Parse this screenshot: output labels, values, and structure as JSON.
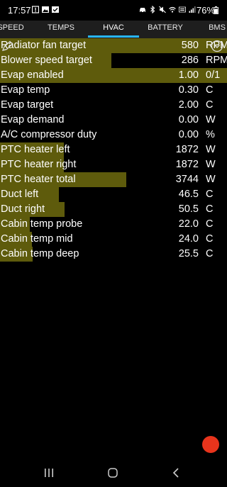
{
  "status_bar": {
    "time": "17:57",
    "battery": "76%",
    "left_icons": [
      "alert-icon",
      "gallery-icon",
      "check-icon"
    ],
    "right_icons": [
      "car-icon",
      "bluetooth-icon",
      "mute-icon",
      "wifi-icon",
      "volte-icon",
      "signal-icon"
    ]
  },
  "tabs": [
    {
      "label": "SPEED",
      "active": false
    },
    {
      "label": "TEMPS",
      "active": false
    },
    {
      "label": "HVAC",
      "active": true
    },
    {
      "label": "BATTERY",
      "active": false
    },
    {
      "label": "BMS",
      "active": false
    }
  ],
  "bar_color": "#5e5b0c",
  "accent_color": "#29b6f6",
  "rows": [
    {
      "label": "Radiator fan target",
      "value": "580",
      "unit": "RPM",
      "bar_fraction": 1.0
    },
    {
      "label": "Blower speed target",
      "value": "286",
      "unit": "RPM",
      "bar_fraction": 0.49
    },
    {
      "label": "Evap enabled",
      "value": "1.00",
      "unit": "0/1",
      "bar_fraction": 1.0
    },
    {
      "label": "Evap temp",
      "value": "0.30",
      "unit": "C",
      "bar_fraction": 0.0
    },
    {
      "label": "Evap target",
      "value": "2.00",
      "unit": "C",
      "bar_fraction": 0.0
    },
    {
      "label": "Evap demand",
      "value": "0.00",
      "unit": "W",
      "bar_fraction": 0.0
    },
    {
      "label": "A/C compressor duty",
      "value": "0.00",
      "unit": "%",
      "bar_fraction": 0.0
    },
    {
      "label": "PTC heater left",
      "value": "1872",
      "unit": "W",
      "bar_fraction": 0.28
    },
    {
      "label": "PTC heater right",
      "value": "1872",
      "unit": "W",
      "bar_fraction": 0.28
    },
    {
      "label": "PTC heater total",
      "value": "3744",
      "unit": "W",
      "bar_fraction": 0.555
    },
    {
      "label": "Duct left",
      "value": "46.5",
      "unit": "C",
      "bar_fraction": 0.26
    },
    {
      "label": "Duct right",
      "value": "50.5",
      "unit": "C",
      "bar_fraction": 0.285
    },
    {
      "label": "Cabin temp probe",
      "value": "22.0",
      "unit": "C",
      "bar_fraction": 0.13
    },
    {
      "label": "Cabin temp mid",
      "value": "24.0",
      "unit": "C",
      "bar_fraction": 0.14
    },
    {
      "label": "Cabin temp deep",
      "value": "25.5",
      "unit": "C",
      "bar_fraction": 0.145
    }
  ]
}
